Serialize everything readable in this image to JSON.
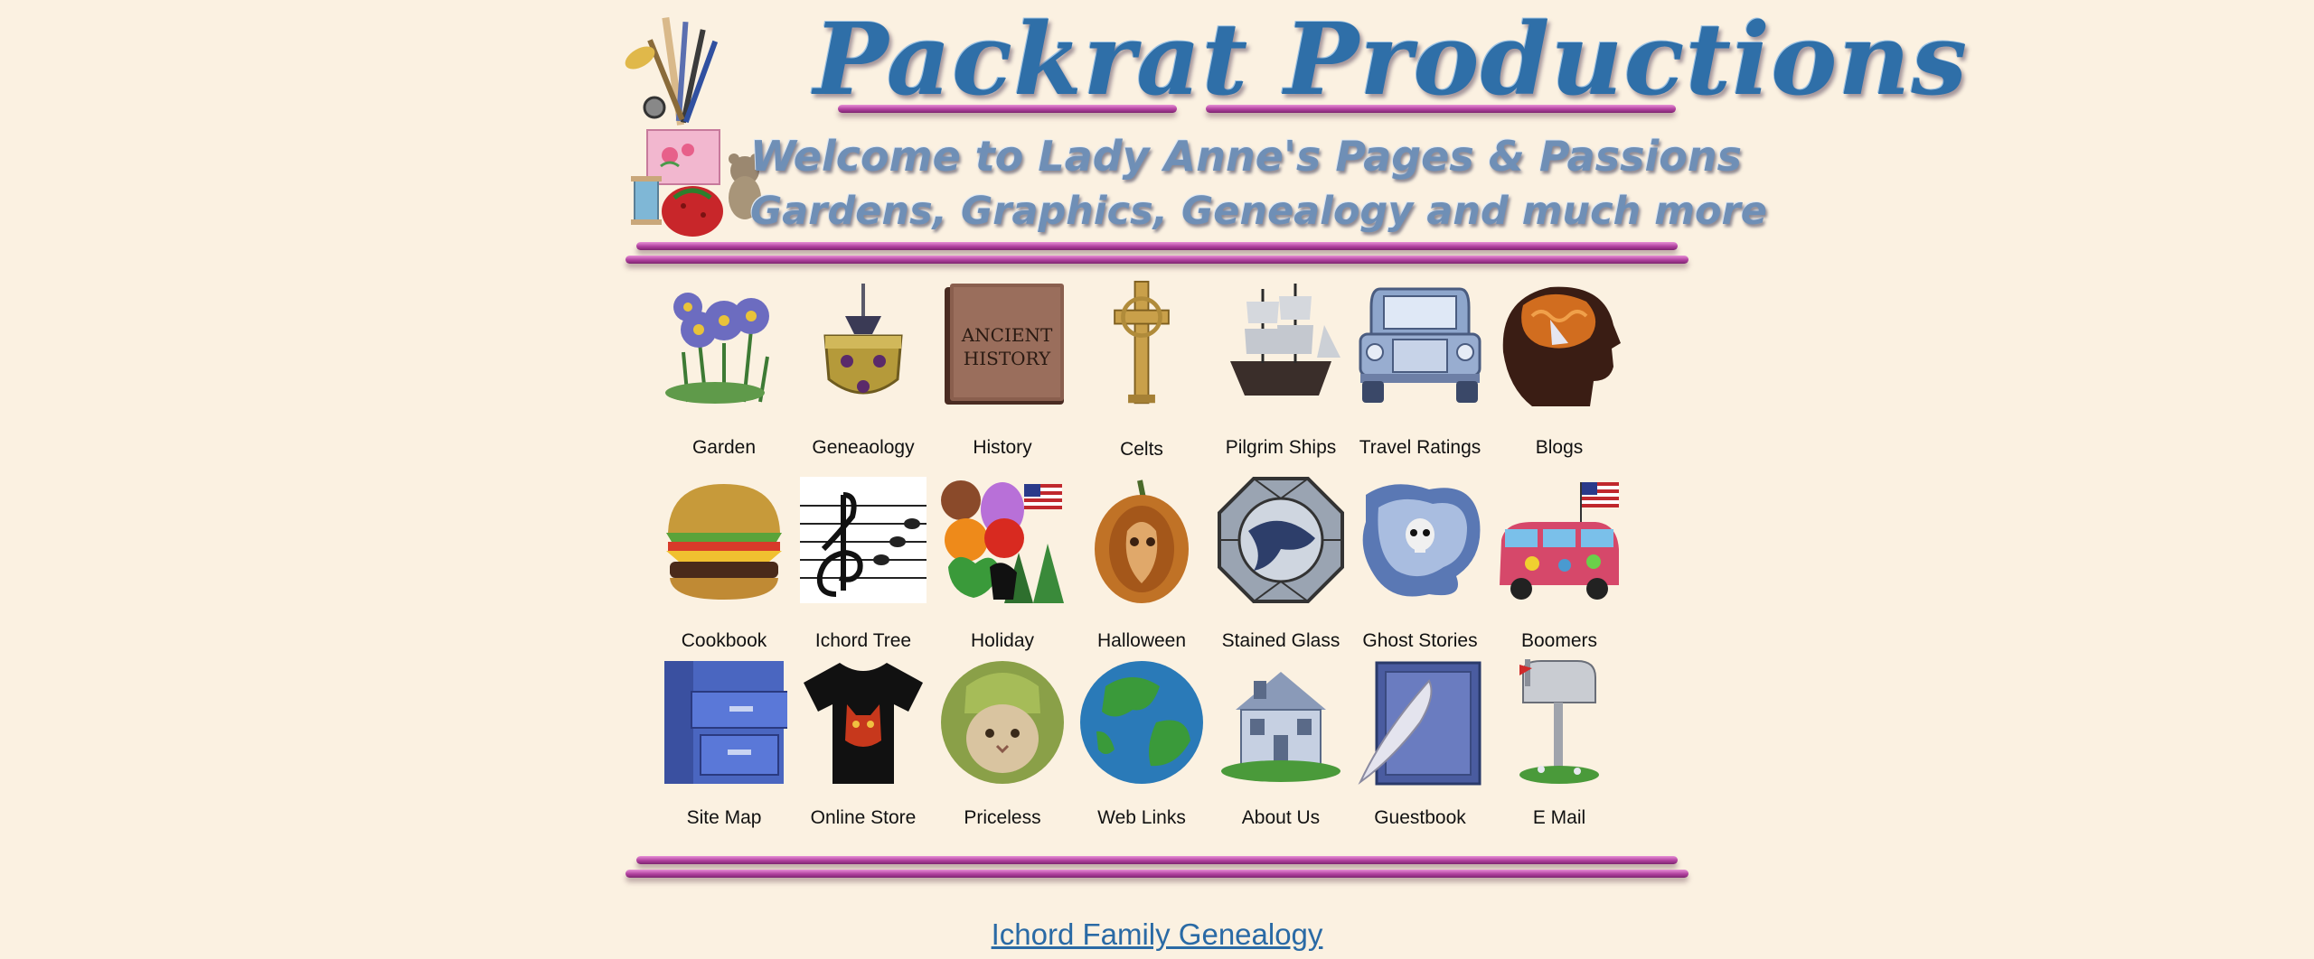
{
  "header": {
    "title": "Packrat Productions",
    "welcome": "Welcome to Lady Anne's Pages & Passions",
    "tagline": "Gardens, Graphics, Genealogy and much more"
  },
  "grid": {
    "items": [
      {
        "label": "Garden",
        "icon": "flower-icon"
      },
      {
        "label": "Geneaology",
        "icon": "coat-of-arms-icon"
      },
      {
        "label": "History",
        "icon": "ancient-history-book-icon"
      },
      {
        "label": "Celts",
        "icon": "celtic-cross-icon"
      },
      {
        "label": "Pilgrim Ships",
        "icon": "ship-icon"
      },
      {
        "label": "Travel Ratings",
        "icon": "truck-icon"
      },
      {
        "label": "Blogs",
        "icon": "brain-head-icon"
      },
      {
        "label": "Cookbook",
        "icon": "burger-icon"
      },
      {
        "label": "Ichord Tree",
        "icon": "treble-clef-icon"
      },
      {
        "label": "Holiday",
        "icon": "holiday-collage-icon"
      },
      {
        "label": "Halloween",
        "icon": "pumpkin-icon"
      },
      {
        "label": "Stained Glass",
        "icon": "stained-glass-icon"
      },
      {
        "label": "Ghost Stories",
        "icon": "ghost-skull-icon"
      },
      {
        "label": "Boomers",
        "icon": "hippie-van-icon"
      },
      {
        "label": "Site Map",
        "icon": "file-cabinet-icon"
      },
      {
        "label": "Online Store",
        "icon": "tshirt-icon"
      },
      {
        "label": "Priceless",
        "icon": "cat-icon"
      },
      {
        "label": "Web Links",
        "icon": "globe-icon"
      },
      {
        "label": "About Us",
        "icon": "house-icon"
      },
      {
        "label": "Guestbook",
        "icon": "guestbook-quill-icon"
      },
      {
        "label": "E Mail",
        "icon": "mailbox-icon"
      }
    ],
    "ancient_history_text": [
      "ANCIENT",
      "HISTORY"
    ]
  },
  "footer": {
    "link": "Ichord Family Genealogy"
  },
  "colors": {
    "background": "#fbf1e1",
    "title_blue": "#2f6fa8",
    "pink_bar": "#b0409e",
    "link_blue": "#2a6aa5"
  }
}
